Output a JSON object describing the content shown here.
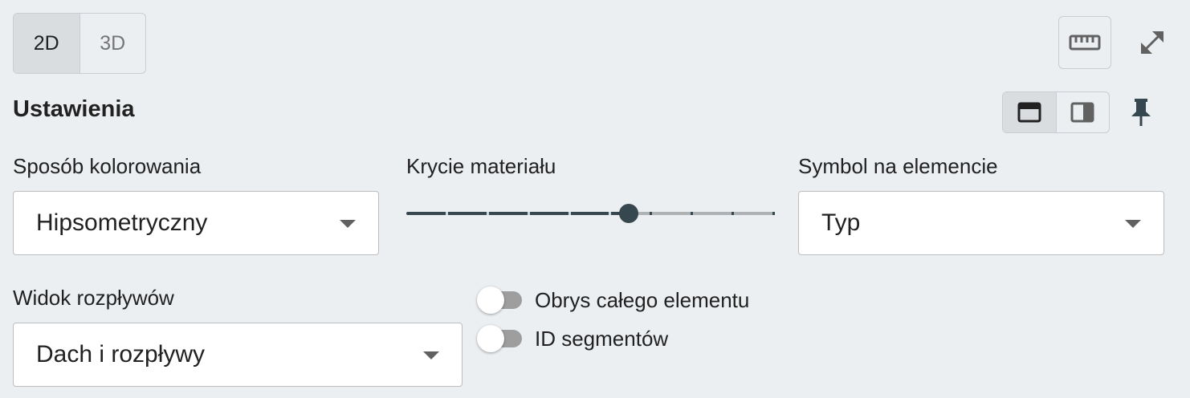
{
  "view_toggle": {
    "options": [
      "2D",
      "3D"
    ],
    "selected": "2D"
  },
  "toolbar": {
    "ruler_icon": "ruler-icon",
    "expand_icon": "expand-icon"
  },
  "settings": {
    "title": "Ustawienia",
    "layout_options": [
      "layout-top-icon",
      "layout-side-icon"
    ],
    "layout_selected": "layout-top-icon",
    "pin_icon": "pin-icon"
  },
  "coloring": {
    "label": "Sposób kolorowania",
    "value": "Hipsometryczny"
  },
  "opacity": {
    "label": "Krycie materiału",
    "value_fraction": 0.6,
    "steps": 9
  },
  "symbol": {
    "label": "Symbol na elemencie",
    "value": "Typ"
  },
  "flow_view": {
    "label": "Widok rozpływów",
    "value": "Dach i rozpływy"
  },
  "toggles": [
    {
      "label": "Obrys całego elementu",
      "checked": false
    },
    {
      "label": "ID segmentów",
      "checked": false
    }
  ],
  "colors": {
    "background": "#eceff2",
    "accent": "#37474f",
    "track_inactive": "#b0b3b6"
  }
}
